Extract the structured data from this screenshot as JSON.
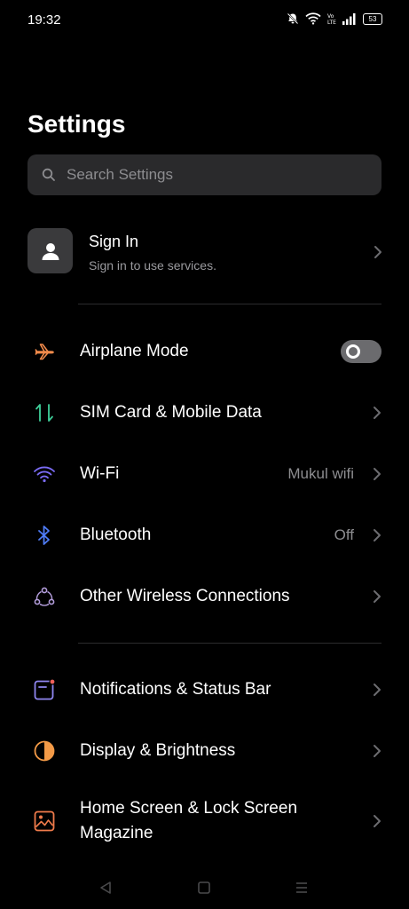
{
  "status": {
    "time": "19:32",
    "battery": "53"
  },
  "title": "Settings",
  "search": {
    "placeholder": "Search Settings"
  },
  "signin": {
    "title": "Sign In",
    "subtitle": "Sign in to use services."
  },
  "rows": {
    "airplane": {
      "label": "Airplane Mode",
      "toggle_on": false
    },
    "sim": {
      "label": "SIM Card & Mobile Data"
    },
    "wifi": {
      "label": "Wi-Fi",
      "value": "Mukul wifi"
    },
    "bluetooth": {
      "label": "Bluetooth",
      "value": "Off"
    },
    "wireless": {
      "label": "Other Wireless Connections"
    },
    "notifications": {
      "label": "Notifications & Status Bar"
    },
    "display": {
      "label": "Display & Brightness"
    },
    "home": {
      "label": "Home Screen & Lock Screen Magazine"
    }
  },
  "colors": {
    "airplane": "#f08a4b",
    "sim": "#3ecf9a",
    "wifi": "#7b6cf6",
    "bluetooth": "#4f7cf7",
    "wireless": "#b39ddb",
    "notifications": "#8f86f0",
    "display": "#f39a47",
    "home": "#f07b4b"
  }
}
